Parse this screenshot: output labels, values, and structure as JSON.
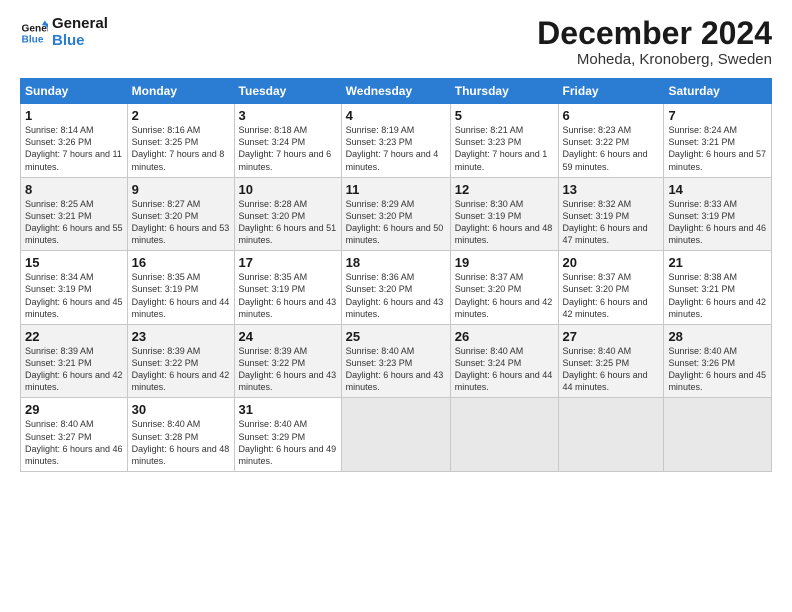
{
  "logo": {
    "line1": "General",
    "line2": "Blue"
  },
  "title": "December 2024",
  "subtitle": "Moheda, Kronoberg, Sweden",
  "headers": [
    "Sunday",
    "Monday",
    "Tuesday",
    "Wednesday",
    "Thursday",
    "Friday",
    "Saturday"
  ],
  "weeks": [
    [
      {
        "day": "1",
        "sunrise": "8:14 AM",
        "sunset": "3:26 PM",
        "daylight": "7 hours and 11 minutes."
      },
      {
        "day": "2",
        "sunrise": "8:16 AM",
        "sunset": "3:25 PM",
        "daylight": "7 hours and 8 minutes."
      },
      {
        "day": "3",
        "sunrise": "8:18 AM",
        "sunset": "3:24 PM",
        "daylight": "7 hours and 6 minutes."
      },
      {
        "day": "4",
        "sunrise": "8:19 AM",
        "sunset": "3:23 PM",
        "daylight": "7 hours and 4 minutes."
      },
      {
        "day": "5",
        "sunrise": "8:21 AM",
        "sunset": "3:23 PM",
        "daylight": "7 hours and 1 minute."
      },
      {
        "day": "6",
        "sunrise": "8:23 AM",
        "sunset": "3:22 PM",
        "daylight": "6 hours and 59 minutes."
      },
      {
        "day": "7",
        "sunrise": "8:24 AM",
        "sunset": "3:21 PM",
        "daylight": "6 hours and 57 minutes."
      }
    ],
    [
      {
        "day": "8",
        "sunrise": "8:25 AM",
        "sunset": "3:21 PM",
        "daylight": "6 hours and 55 minutes."
      },
      {
        "day": "9",
        "sunrise": "8:27 AM",
        "sunset": "3:20 PM",
        "daylight": "6 hours and 53 minutes."
      },
      {
        "day": "10",
        "sunrise": "8:28 AM",
        "sunset": "3:20 PM",
        "daylight": "6 hours and 51 minutes."
      },
      {
        "day": "11",
        "sunrise": "8:29 AM",
        "sunset": "3:20 PM",
        "daylight": "6 hours and 50 minutes."
      },
      {
        "day": "12",
        "sunrise": "8:30 AM",
        "sunset": "3:19 PM",
        "daylight": "6 hours and 48 minutes."
      },
      {
        "day": "13",
        "sunrise": "8:32 AM",
        "sunset": "3:19 PM",
        "daylight": "6 hours and 47 minutes."
      },
      {
        "day": "14",
        "sunrise": "8:33 AM",
        "sunset": "3:19 PM",
        "daylight": "6 hours and 46 minutes."
      }
    ],
    [
      {
        "day": "15",
        "sunrise": "8:34 AM",
        "sunset": "3:19 PM",
        "daylight": "6 hours and 45 minutes."
      },
      {
        "day": "16",
        "sunrise": "8:35 AM",
        "sunset": "3:19 PM",
        "daylight": "6 hours and 44 minutes."
      },
      {
        "day": "17",
        "sunrise": "8:35 AM",
        "sunset": "3:19 PM",
        "daylight": "6 hours and 43 minutes."
      },
      {
        "day": "18",
        "sunrise": "8:36 AM",
        "sunset": "3:20 PM",
        "daylight": "6 hours and 43 minutes."
      },
      {
        "day": "19",
        "sunrise": "8:37 AM",
        "sunset": "3:20 PM",
        "daylight": "6 hours and 42 minutes."
      },
      {
        "day": "20",
        "sunrise": "8:37 AM",
        "sunset": "3:20 PM",
        "daylight": "6 hours and 42 minutes."
      },
      {
        "day": "21",
        "sunrise": "8:38 AM",
        "sunset": "3:21 PM",
        "daylight": "6 hours and 42 minutes."
      }
    ],
    [
      {
        "day": "22",
        "sunrise": "8:39 AM",
        "sunset": "3:21 PM",
        "daylight": "6 hours and 42 minutes."
      },
      {
        "day": "23",
        "sunrise": "8:39 AM",
        "sunset": "3:22 PM",
        "daylight": "6 hours and 42 minutes."
      },
      {
        "day": "24",
        "sunrise": "8:39 AM",
        "sunset": "3:22 PM",
        "daylight": "6 hours and 43 minutes."
      },
      {
        "day": "25",
        "sunrise": "8:40 AM",
        "sunset": "3:23 PM",
        "daylight": "6 hours and 43 minutes."
      },
      {
        "day": "26",
        "sunrise": "8:40 AM",
        "sunset": "3:24 PM",
        "daylight": "6 hours and 44 minutes."
      },
      {
        "day": "27",
        "sunrise": "8:40 AM",
        "sunset": "3:25 PM",
        "daylight": "6 hours and 44 minutes."
      },
      {
        "day": "28",
        "sunrise": "8:40 AM",
        "sunset": "3:26 PM",
        "daylight": "6 hours and 45 minutes."
      }
    ],
    [
      {
        "day": "29",
        "sunrise": "8:40 AM",
        "sunset": "3:27 PM",
        "daylight": "6 hours and 46 minutes."
      },
      {
        "day": "30",
        "sunrise": "8:40 AM",
        "sunset": "3:28 PM",
        "daylight": "6 hours and 48 minutes."
      },
      {
        "day": "31",
        "sunrise": "8:40 AM",
        "sunset": "3:29 PM",
        "daylight": "6 hours and 49 minutes."
      },
      null,
      null,
      null,
      null
    ]
  ],
  "labels": {
    "sunrise": "Sunrise:",
    "sunset": "Sunset:",
    "daylight": "Daylight:"
  }
}
